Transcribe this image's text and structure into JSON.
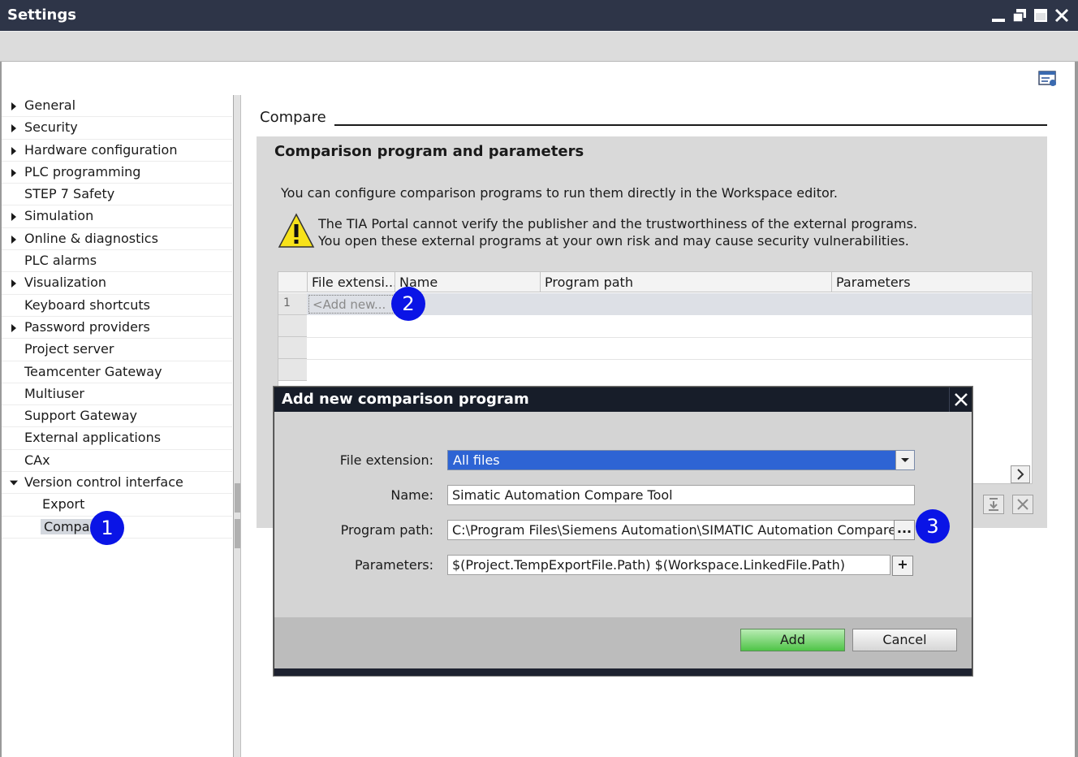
{
  "window": {
    "title": "Settings"
  },
  "nav": {
    "items": [
      {
        "label": "General",
        "expandable": true
      },
      {
        "label": "Security",
        "expandable": true
      },
      {
        "label": "Hardware configuration",
        "expandable": true
      },
      {
        "label": "PLC programming",
        "expandable": true
      },
      {
        "label": "STEP 7 Safety",
        "expandable": false
      },
      {
        "label": "Simulation",
        "expandable": true
      },
      {
        "label": "Online & diagnostics",
        "expandable": true
      },
      {
        "label": "PLC alarms",
        "expandable": false
      },
      {
        "label": "Visualization",
        "expandable": true
      },
      {
        "label": "Keyboard shortcuts",
        "expandable": false
      },
      {
        "label": "Password providers",
        "expandable": true
      },
      {
        "label": "Project server",
        "expandable": false
      },
      {
        "label": "Teamcenter Gateway",
        "expandable": false
      },
      {
        "label": "Multiuser",
        "expandable": false
      },
      {
        "label": "Support Gateway",
        "expandable": false
      },
      {
        "label": "External applications",
        "expandable": false
      },
      {
        "label": "CAx",
        "expandable": false
      },
      {
        "label": "Version control interface",
        "expandable": true,
        "expanded": true
      },
      {
        "label": "Export",
        "child": true
      },
      {
        "label": "Compare",
        "child": true,
        "selected": true
      }
    ]
  },
  "content": {
    "section_title": "Compare",
    "panel_heading": "Comparison program and parameters",
    "info_text": "You can configure comparison programs to run them directly in the Workspace editor.",
    "warning_line1": "The TIA Portal cannot verify the publisher and the trustworthiness of the external programs.",
    "warning_line2": "You open these external programs at your own risk and may cause security vulnerabilities.",
    "table": {
      "columns": [
        "File extensi...",
        "Name",
        "Program path",
        "Parameters"
      ],
      "row1_number": "1",
      "add_new": "<Add new..."
    }
  },
  "dialog": {
    "title": "Add new comparison program",
    "file_extension_label": "File extension:",
    "file_extension_value": "All files",
    "name_label": "Name:",
    "name_value": "Simatic Automation Compare Tool",
    "program_path_label": "Program path:",
    "program_path_value": "C:\\Program Files\\Siemens Automation\\SIMATIC Automation Compare Tool",
    "browse_label": "...",
    "parameters_label": "Parameters:",
    "parameters_value": "$(Project.TempExportFile.Path) $(Workspace.LinkedFile.Path)",
    "plus_label": "+",
    "add_label": "Add",
    "cancel_label": "Cancel"
  },
  "callouts": {
    "one": "1",
    "two": "2",
    "three": "3"
  },
  "colors": {
    "titlebar": "#2e3548",
    "dialog_titlebar": "#171d29",
    "callout": "#0a14e6",
    "selection": "#2e64d4",
    "add_button": "#4fc448"
  }
}
